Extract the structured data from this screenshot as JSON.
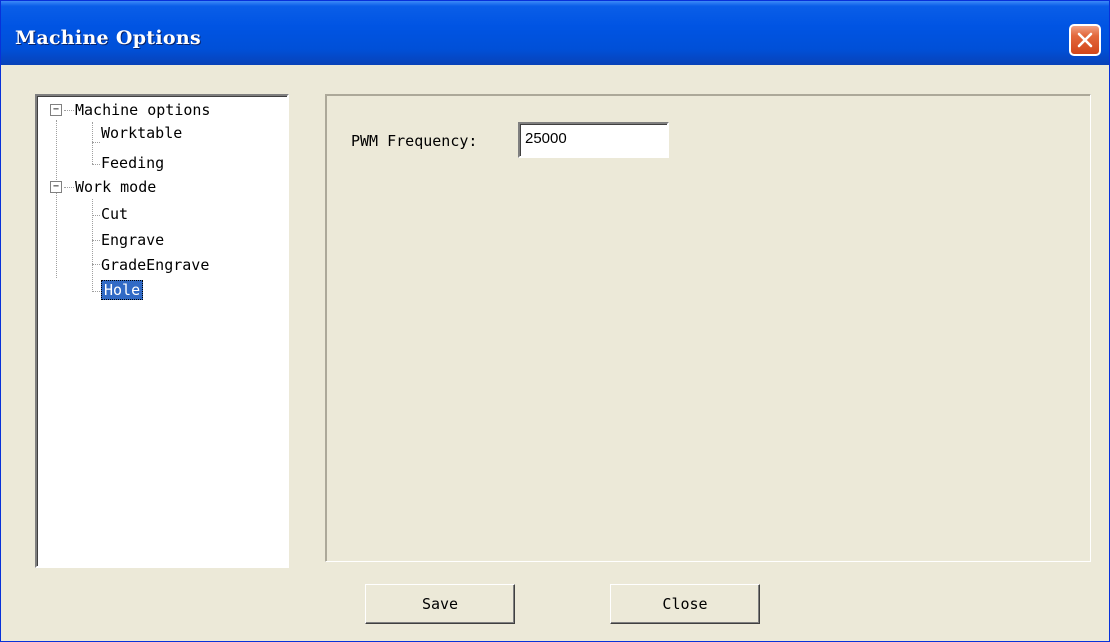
{
  "window": {
    "title": "Machine Options"
  },
  "tree": {
    "items": [
      {
        "label": "Machine options",
        "level": 0,
        "expanded": true
      },
      {
        "label": "Worktable",
        "level": 1
      },
      {
        "label": "Feeding",
        "level": 1
      },
      {
        "label": "Work mode",
        "level": 0,
        "expanded": true
      },
      {
        "label": "Cut",
        "level": 1
      },
      {
        "label": "Engrave",
        "level": 1
      },
      {
        "label": "GradeEngrave",
        "level": 1
      },
      {
        "label": "Hole",
        "level": 1,
        "selected": true
      }
    ]
  },
  "form": {
    "pwm_label": "PWM Frequency:",
    "pwm_value": "25000"
  },
  "buttons": {
    "save": "Save",
    "close": "Close"
  },
  "colors": {
    "titlebar": "#0054e3",
    "dialog_bg": "#ece9d8",
    "selection": "#316ac5",
    "close_button": "#d2451a"
  },
  "icons": [
    "close-icon",
    "minus-expander-icon"
  ]
}
